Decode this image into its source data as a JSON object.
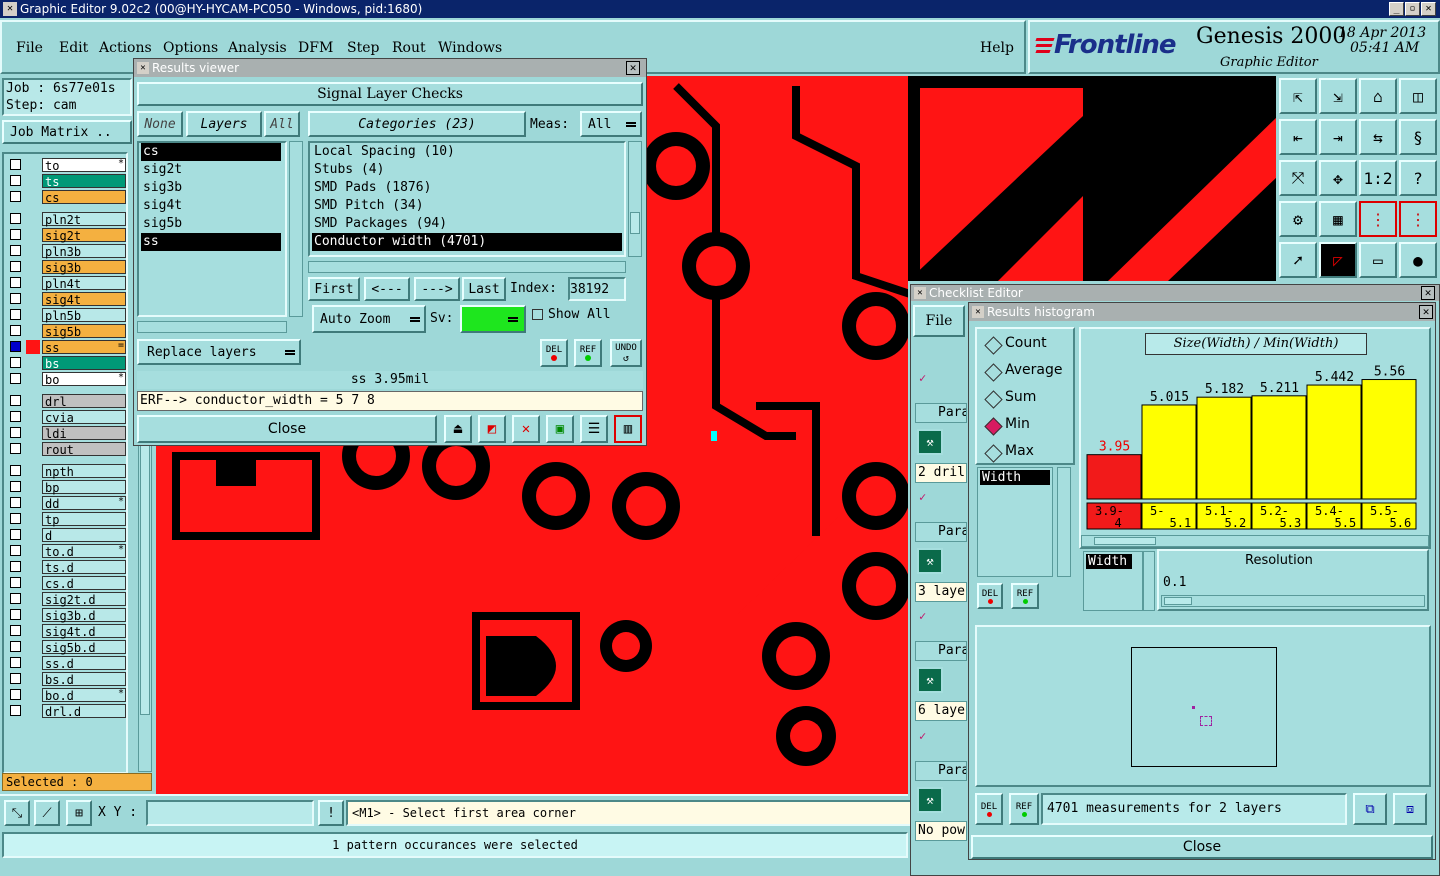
{
  "window": {
    "title": "Graphic Editor 9.02c2 (00@HY-HYCAM-PC050 - Windows, pid:1680)"
  },
  "menu": [
    "File",
    "Edit",
    "Actions",
    "Options",
    "Analysis",
    "DFM",
    "Step",
    "Rout",
    "Windows"
  ],
  "help": "Help",
  "brand": {
    "logo": "Frontline",
    "product": "Genesis 2000",
    "date": "18 Apr 2013",
    "time": "05:41 AM",
    "subtitle": "Graphic Editor"
  },
  "job": {
    "job": "Job : 6s77e01s",
    "step": "Step: cam",
    "matrix": "Job Matrix .."
  },
  "layers": [
    {
      "name": "to",
      "color": "#ffffff",
      "mark": "*"
    },
    {
      "name": "ts",
      "color": "#009977"
    },
    {
      "name": "cs",
      "color": "#f4b040"
    },
    {
      "name": "pln2t",
      "color": "#b8e8e8"
    },
    {
      "name": "sig2t",
      "color": "#f4b040"
    },
    {
      "name": "pln3b",
      "color": "#b8e8e8"
    },
    {
      "name": "sig3b",
      "color": "#f4b040"
    },
    {
      "name": "pln4t",
      "color": "#b8e8e8"
    },
    {
      "name": "sig4t",
      "color": "#f4b040"
    },
    {
      "name": "pln5b",
      "color": "#b8e8e8"
    },
    {
      "name": "sig5b",
      "color": "#f4b040"
    },
    {
      "name": "ss",
      "color": "#f4b040",
      "mark": "="
    },
    {
      "name": "bs",
      "color": "#009977"
    },
    {
      "name": "bo",
      "color": "#ffffff",
      "mark": "*"
    },
    {
      "name": "drl",
      "color": "#c0c0c0"
    },
    {
      "name": "cvia",
      "color": "#b8e8e8"
    },
    {
      "name": "ldi",
      "color": "#c0c0c0"
    },
    {
      "name": "rout",
      "color": "#c0c0c0"
    },
    {
      "name": "npth",
      "color": "#b8e8e8"
    },
    {
      "name": "bp",
      "color": "#b8e8e8"
    },
    {
      "name": "dd",
      "color": "#b8e8e8",
      "mark": "*"
    },
    {
      "name": "tp",
      "color": "#b8e8e8"
    },
    {
      "name": "d",
      "color": "#b8e8e8"
    },
    {
      "name": "to.d",
      "color": "#b8e8e8",
      "mark": "*"
    },
    {
      "name": "ts.d",
      "color": "#b8e8e8"
    },
    {
      "name": "cs.d",
      "color": "#b8e8e8"
    },
    {
      "name": "sig2t.d",
      "color": "#b8e8e8"
    },
    {
      "name": "sig3b.d",
      "color": "#b8e8e8"
    },
    {
      "name": "sig4t.d",
      "color": "#b8e8e8"
    },
    {
      "name": "sig5b.d",
      "color": "#b8e8e8"
    },
    {
      "name": "ss.d",
      "color": "#b8e8e8"
    },
    {
      "name": "bs.d",
      "color": "#b8e8e8"
    },
    {
      "name": "bo.d",
      "color": "#b8e8e8",
      "mark": "*"
    },
    {
      "name": "drl.d",
      "color": "#b8e8e8"
    }
  ],
  "selected": "Selected : 0",
  "coords": {
    "label": "X Y :",
    "value": "",
    "prompt": "<M1> - Select first area corner"
  },
  "status": "1 pattern occurances were selected",
  "results": {
    "title": "Results viewer",
    "header": "Signal Layer Checks",
    "none": "None",
    "layers": "Layers",
    "all": "All",
    "categories": "Categories (23)",
    "meas": "Meas:",
    "meas_value": "All",
    "layer_list": [
      "cs",
      "sig2t",
      "sig3b",
      "sig4t",
      "sig5b",
      "ss"
    ],
    "category_list": [
      "Local Spacing (10)",
      "Stubs (4)",
      "SMD Pads (1876)",
      "SMD Pitch (34)",
      "SMD Packages (94)",
      "Conductor width (4701)"
    ],
    "first": "First",
    "prev": "<---",
    "next": "--->",
    "last": "Last",
    "index_label": "Index:",
    "index_value": "38192",
    "auto_zoom": "Auto Zoom",
    "sv": "Sv:",
    "show_all": "Show All",
    "replace": "Replace layers",
    "del": "DEL",
    "ref": "REF",
    "undo": "UNDO",
    "info": "ss 3.95mil",
    "erf": "ERF--> conductor_width = 5 7 8",
    "close": "Close"
  },
  "checklist": {
    "title": "Checklist Editor",
    "file": "File",
    "rows": [
      "Para",
      "2 dril",
      "Para",
      "3 laye",
      "Para",
      "6 laye",
      "Para",
      "No pow"
    ]
  },
  "histogram": {
    "title": "Results histogram",
    "modes": [
      "Count",
      "Average",
      "Sum",
      "Min",
      "Max"
    ],
    "mode_selected": "Min",
    "axis_label": "Size(Width) / Min(Width)",
    "attr": "Width",
    "attr2": "Width",
    "resolution_label": "Resolution",
    "resolution": "0.1",
    "summary": "4701 measurements for 2 layers",
    "close": "Close",
    "del": "DEL",
    "ref": "REF"
  },
  "chart_data": {
    "type": "bar",
    "categories": [
      "3.9-4",
      "5-5.1",
      "5.1-5.2",
      "5.2-5.3",
      "5.4-5.5",
      "5.5-5.6"
    ],
    "values": [
      3.95,
      5.015,
      5.182,
      5.211,
      5.442,
      5.56
    ],
    "value_labels": [
      "3.95",
      "5.015",
      "5.182",
      "5.211",
      "5.442",
      "5.56"
    ],
    "colors": [
      "#f21a1a",
      "#ffff00",
      "#ffff00",
      "#ffff00",
      "#ffff00",
      "#ffff00"
    ],
    "title": "Size(Width) / Min(Width)",
    "ylim": [
      0,
      7
    ]
  }
}
